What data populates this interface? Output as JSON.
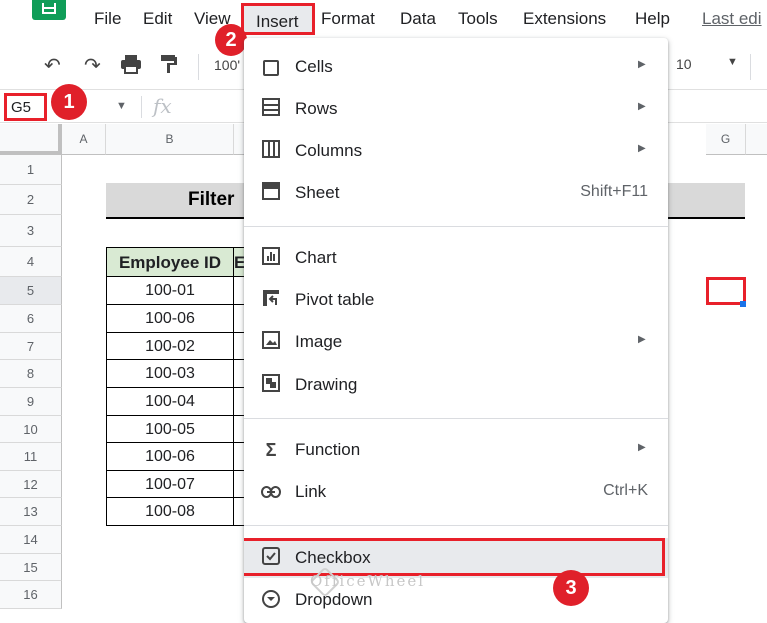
{
  "menubar": {
    "items": [
      "File",
      "Edit",
      "View",
      "Insert",
      "Format",
      "Data",
      "Tools",
      "Extensions",
      "Help"
    ],
    "last_edit": "Last edi"
  },
  "toolbar": {
    "zoom": "100'",
    "font_size": "10"
  },
  "formula_bar": {
    "name_box": "G5",
    "fx": "fx"
  },
  "callouts": [
    "1",
    "2",
    "3"
  ],
  "grid": {
    "columns": [
      "A",
      "B",
      "G"
    ],
    "rows": [
      "1",
      "2",
      "3",
      "4",
      "5",
      "6",
      "7",
      "8",
      "9",
      "10",
      "11",
      "12",
      "13",
      "14",
      "15",
      "16"
    ],
    "title": "Filter",
    "table_header": "Employee ID",
    "table_header_next": "E",
    "employee_ids": [
      "100-01",
      "100-06",
      "100-02",
      "100-03",
      "100-04",
      "100-05",
      "100-06",
      "100-07",
      "100-08"
    ]
  },
  "insert_menu": {
    "items": [
      {
        "label": "Cells",
        "icon": "cells-icon",
        "submenu": true
      },
      {
        "label": "Rows",
        "icon": "rows-icon",
        "submenu": true
      },
      {
        "label": "Columns",
        "icon": "columns-icon",
        "submenu": true
      },
      {
        "label": "Sheet",
        "icon": "sheet-icon",
        "shortcut": "Shift+F11"
      },
      {
        "label": "Chart",
        "icon": "chart-icon"
      },
      {
        "label": "Pivot table",
        "icon": "pivot-table-icon"
      },
      {
        "label": "Image",
        "icon": "image-icon",
        "submenu": true
      },
      {
        "label": "Drawing",
        "icon": "drawing-icon"
      },
      {
        "label": "Function",
        "icon": "sigma-icon",
        "submenu": true
      },
      {
        "label": "Link",
        "icon": "link-icon",
        "shortcut": "Ctrl+K"
      },
      {
        "label": "Checkbox",
        "icon": "checkbox-icon"
      },
      {
        "label": "Dropdown",
        "icon": "dropdown-icon"
      }
    ]
  },
  "watermark": "OfficeWheel",
  "colors": {
    "highlight": "#e8202a",
    "header_green": "#d9ead3",
    "title_gray": "#d9d9d9",
    "sheets_green": "#0f9d58"
  }
}
